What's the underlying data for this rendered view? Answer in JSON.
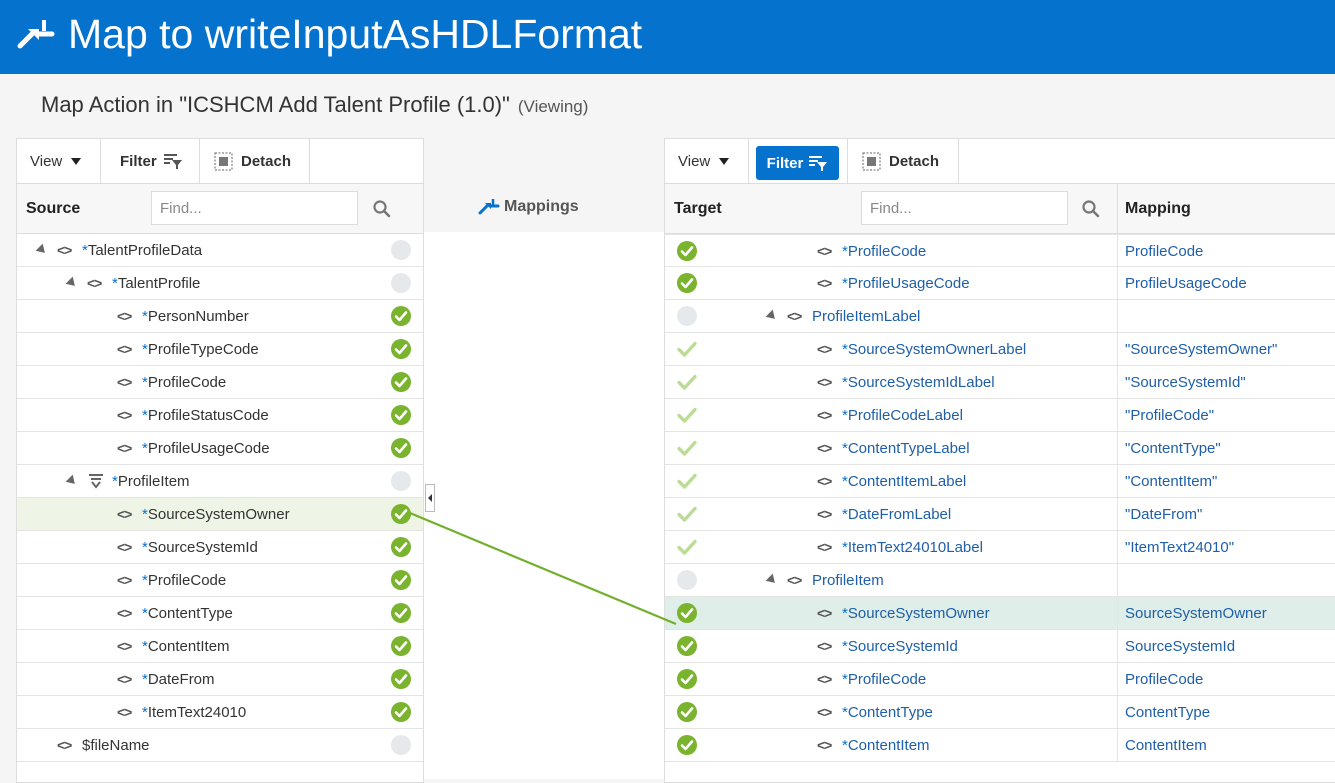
{
  "header": {
    "title": "Map to writeInputAsHDLFormat",
    "icon": "mapper-icon"
  },
  "subheader": {
    "title": "Map Action in \"ICSHCM Add Talent Profile (1.0)\"",
    "status": "(Viewing)"
  },
  "toolbar": {
    "view": "View",
    "filter": "Filter",
    "detach": "Detach"
  },
  "middle": {
    "mappings_label": "Mappings"
  },
  "source": {
    "header": "Source",
    "find_placeholder": "Find...",
    "rows": [
      {
        "label": "TalentProfileData",
        "required": true,
        "status": "unmapped"
      },
      {
        "label": "TalentProfile",
        "required": true,
        "status": "unmapped"
      },
      {
        "label": "PersonNumber",
        "required": true,
        "status": "mapped"
      },
      {
        "label": "ProfileTypeCode",
        "required": true,
        "status": "mapped"
      },
      {
        "label": "ProfileCode",
        "required": true,
        "status": "mapped"
      },
      {
        "label": "ProfileStatusCode",
        "required": true,
        "status": "mapped"
      },
      {
        "label": "ProfileUsageCode",
        "required": true,
        "status": "mapped"
      },
      {
        "label": "ProfileItem",
        "required": true,
        "status": "unmapped"
      },
      {
        "label": "SourceSystemOwner",
        "required": true,
        "status": "mapped",
        "selected": true
      },
      {
        "label": "SourceSystemId",
        "required": true,
        "status": "mapped"
      },
      {
        "label": "ProfileCode",
        "required": true,
        "status": "mapped"
      },
      {
        "label": "ContentType",
        "required": true,
        "status": "mapped"
      },
      {
        "label": "ContentItem",
        "required": true,
        "status": "mapped"
      },
      {
        "label": "DateFrom",
        "required": true,
        "status": "mapped"
      },
      {
        "label": "ItemText24010",
        "required": true,
        "status": "mapped"
      },
      {
        "label": "$fileName",
        "required": false,
        "status": "unmapped"
      }
    ]
  },
  "target": {
    "header": "Target",
    "mapping_header": "Mapping",
    "find_placeholder": "Find...",
    "rows": [
      {
        "label": "ProfileCode",
        "required": true,
        "status": "mapped",
        "mapping": "ProfileCode"
      },
      {
        "label": "ProfileUsageCode",
        "required": true,
        "status": "mapped",
        "mapping": "ProfileUsageCode"
      },
      {
        "label": "ProfileItemLabel",
        "required": false,
        "status": "unmapped",
        "mapping": ""
      },
      {
        "label": "SourceSystemOwnerLabel",
        "required": true,
        "status": "literal",
        "mapping": "\"SourceSystemOwner\""
      },
      {
        "label": "SourceSystemIdLabel",
        "required": true,
        "status": "literal",
        "mapping": "\"SourceSystemId\""
      },
      {
        "label": "ProfileCodeLabel",
        "required": true,
        "status": "literal",
        "mapping": "\"ProfileCode\""
      },
      {
        "label": "ContentTypeLabel",
        "required": true,
        "status": "literal",
        "mapping": "\"ContentType\""
      },
      {
        "label": "ContentItemLabel",
        "required": true,
        "status": "literal",
        "mapping": "\"ContentItem\""
      },
      {
        "label": "DateFromLabel",
        "required": true,
        "status": "literal",
        "mapping": "\"DateFrom\""
      },
      {
        "label": "ItemText24010Label",
        "required": true,
        "status": "literal",
        "mapping": "\"ItemText24010\""
      },
      {
        "label": "ProfileItem",
        "required": false,
        "status": "unmapped",
        "mapping": ""
      },
      {
        "label": "SourceSystemOwner",
        "required": true,
        "status": "mapped",
        "mapping": "SourceSystemOwner",
        "selected": true
      },
      {
        "label": "SourceSystemId",
        "required": true,
        "status": "mapped",
        "mapping": "SourceSystemId"
      },
      {
        "label": "ProfileCode",
        "required": true,
        "status": "mapped",
        "mapping": "ProfileCode"
      },
      {
        "label": "ContentType",
        "required": true,
        "status": "mapped",
        "mapping": "ContentType"
      },
      {
        "label": "ContentItem",
        "required": true,
        "status": "mapped",
        "mapping": "ContentItem"
      }
    ]
  },
  "colors": {
    "header_bg": "#0572ce",
    "mapped": "#7ab32e",
    "literal": "#bcdc96",
    "unmapped": "#e6e9eb",
    "line": "#72b02c"
  }
}
